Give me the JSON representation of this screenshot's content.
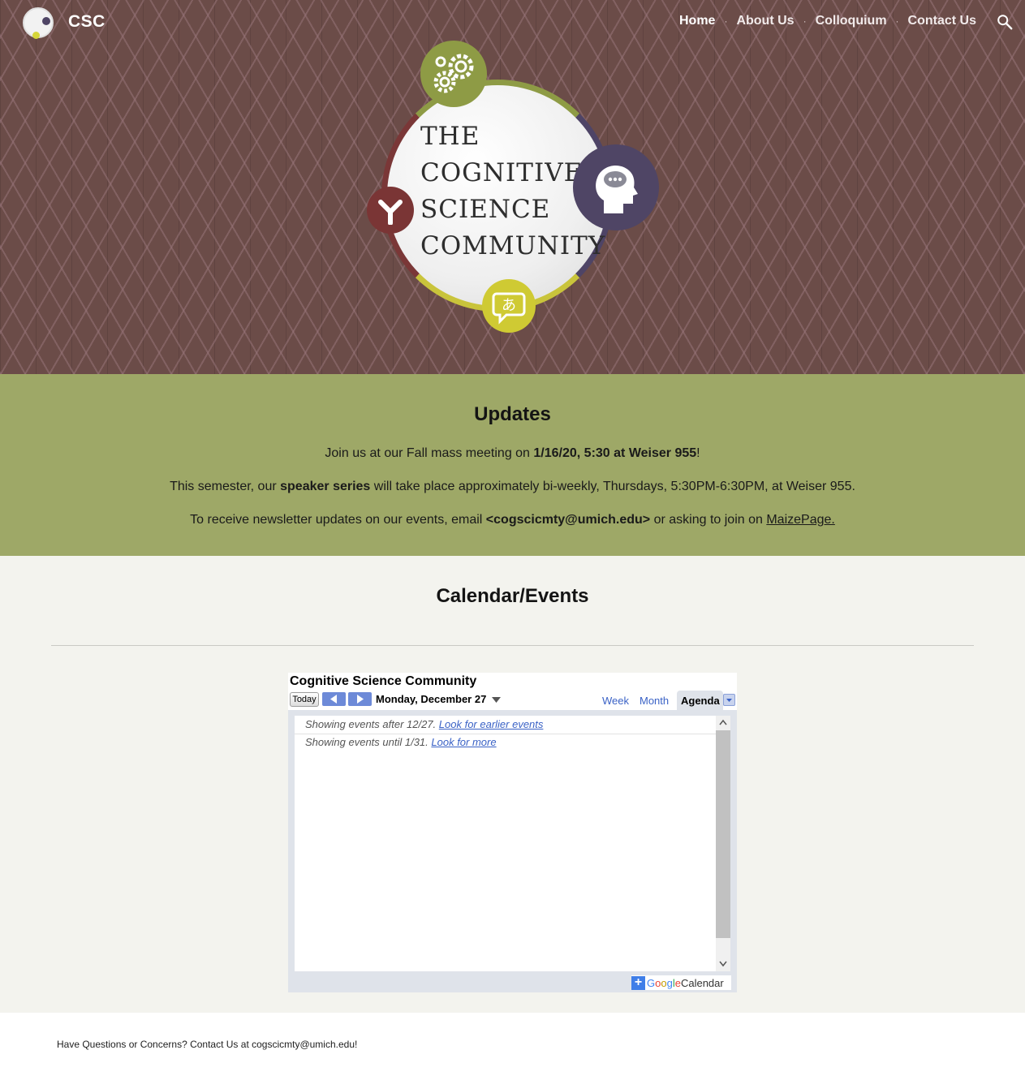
{
  "header": {
    "site_title": "CSC",
    "nav": [
      {
        "label": "Home",
        "active": true
      },
      {
        "label": "About Us",
        "active": false
      },
      {
        "label": "Colloquium",
        "active": false
      },
      {
        "label": "Contact Us",
        "active": false
      }
    ],
    "separator": "·",
    "search_icon": "search-icon"
  },
  "hero": {
    "logo_text": [
      "THE",
      "COGNITIVE",
      "SCIENCE",
      "COMMUNITY"
    ],
    "badge_icons": [
      "gears-icon",
      "head-thought-icon",
      "branch-icon",
      "language-bubble-icon"
    ],
    "background_color": "#6b4c48"
  },
  "updates": {
    "heading": "Updates",
    "line1_pre": "Join us at our Fall mass meeting on ",
    "line1_bold": "1/16/20, 5:30 at Weiser 955",
    "line1_post": "!",
    "line2_pre": "This semester, our ",
    "line2_bold": "speaker series",
    "line2_post": " will take place approximately bi-weekly, Thursdays, 5:30PM-6:30PM, at Weiser 955.",
    "line3_pre": "To receive newsletter updates on our events, email ",
    "line3_bold": "<cogscicmty@umich.edu>",
    "line3_mid": " or asking to join on ",
    "line3_link": "MaizePage.",
    "background_color": "#9ea867"
  },
  "calendar_section": {
    "heading": "Calendar/Events",
    "widget": {
      "title": "Cognitive Science Community",
      "today_label": "Today",
      "date_label": "Monday, December 27",
      "tabs": {
        "week": "Week",
        "month": "Month",
        "agenda": "Agenda"
      },
      "active_tab": "Agenda",
      "row1_text": "Showing events after 12/27. ",
      "row1_link": "Look for earlier events",
      "row2_text": "Showing events until 1/31. ",
      "row2_link": "Look for more",
      "footer_brand": [
        "G",
        "o",
        "o",
        "g",
        "l",
        "e"
      ],
      "footer_suffix": "Calendar",
      "footer_plus": "+"
    }
  },
  "footer": {
    "text": "Have Questions or Concerns? Contact Us at cogscicmty@umich.edu!"
  }
}
